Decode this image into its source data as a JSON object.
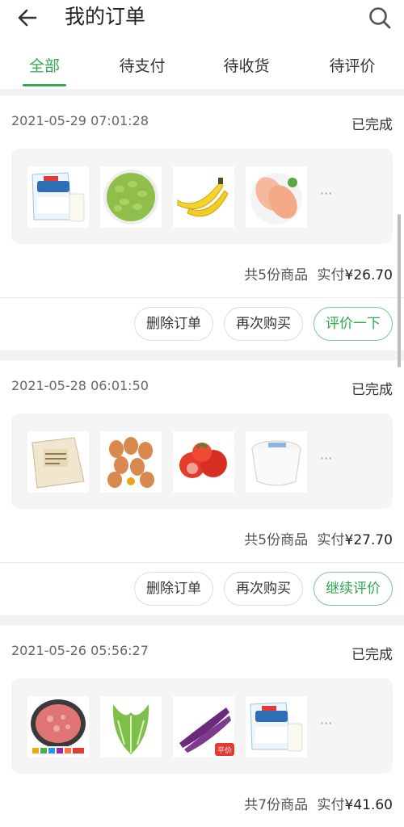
{
  "header": {
    "title": "我的订单",
    "back_icon": "arrow-left-icon",
    "search_icon": "search-icon"
  },
  "tabs": [
    {
      "label": "全部",
      "active": true
    },
    {
      "label": "待支付",
      "active": false
    },
    {
      "label": "待收货",
      "active": false
    },
    {
      "label": "待评价",
      "active": false
    }
  ],
  "colors": {
    "accent": "#2fa84f",
    "background": "#f2f2f2"
  },
  "orders": [
    {
      "time": "2021-05-29 07:01:28",
      "status": "已完成",
      "items": [
        "milk-bag-image",
        "edamame-image",
        "banana-image",
        "chicken-breast-image"
      ],
      "more": "···",
      "count_text": "共5份商品",
      "paid_label": "实付",
      "paid_amount": "¥26.70",
      "buttons": [
        "删除订单",
        "再次购买",
        "评价一下"
      ]
    },
    {
      "time": "2021-05-28 06:01:50",
      "status": "已完成",
      "items": [
        "soy-milk-bag-image",
        "eggs-image",
        "tomatoes-image",
        "yogurt-cup-image"
      ],
      "more": "···",
      "count_text": "共5份商品",
      "paid_label": "实付",
      "paid_amount": "¥27.70",
      "buttons": [
        "删除订单",
        "再次购买",
        "继续评价"
      ]
    },
    {
      "time": "2021-05-26 05:56:27",
      "status": "已完成",
      "items": [
        "minced-pork-image",
        "lettuce-image",
        "eggplant-image",
        "milk-bag-image"
      ],
      "badge": "平价",
      "more": "···",
      "count_text": "共7份商品",
      "paid_label": "实付",
      "paid_amount": "¥41.60"
    }
  ]
}
